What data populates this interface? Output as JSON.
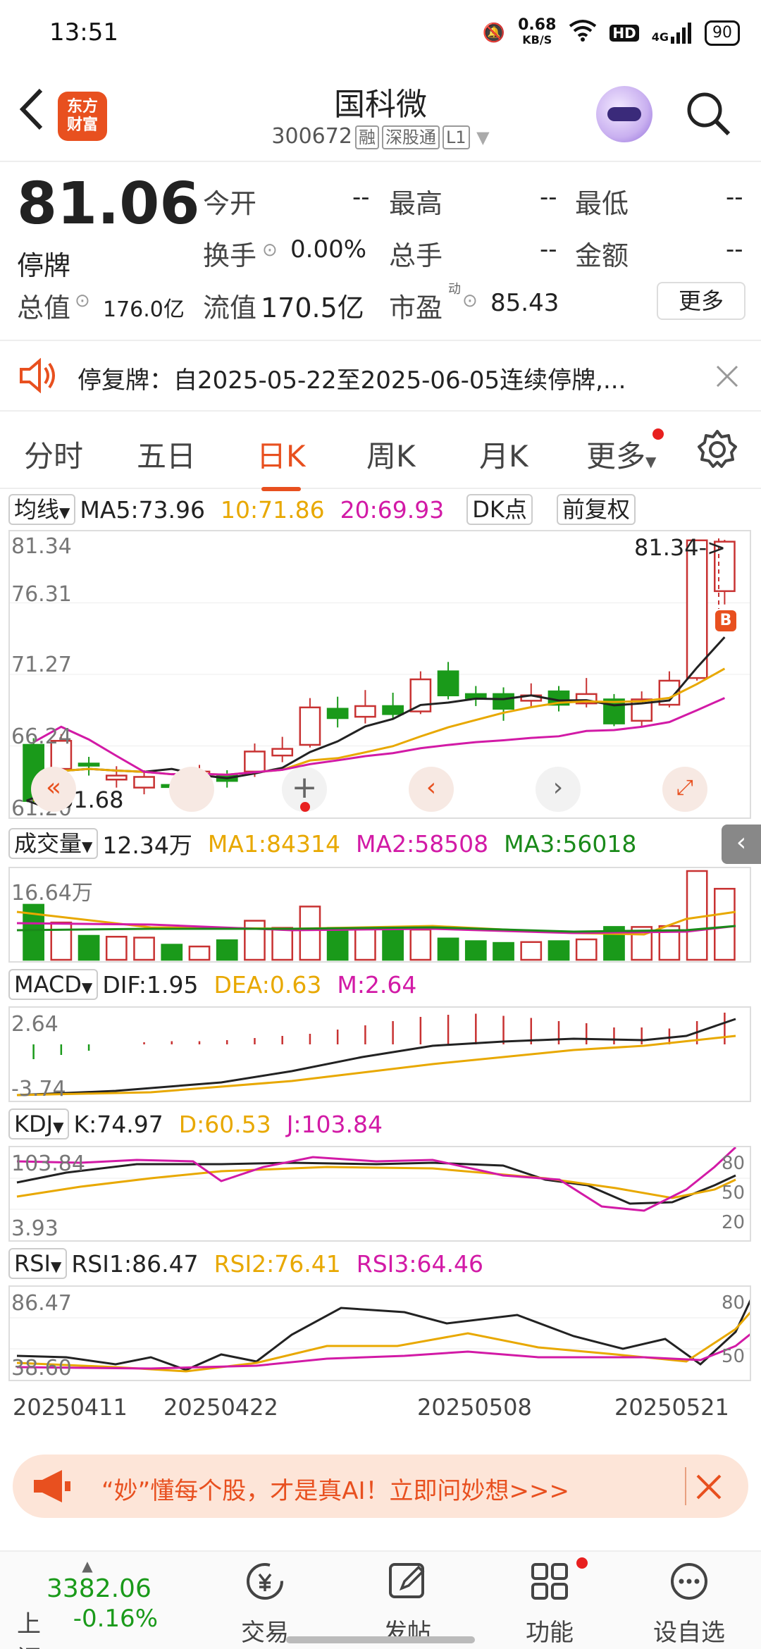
{
  "status": {
    "time": "13:51",
    "speed": "0.68",
    "speed_unit": "KB/S",
    "hd": "HD",
    "net": "4G",
    "battery": "90"
  },
  "header": {
    "logo_line1": "东方",
    "logo_line2": "财富",
    "name": "国科微",
    "code": "300672",
    "tags": [
      "融",
      "深股通",
      "L1"
    ]
  },
  "quote": {
    "price": "81.06",
    "state": "停牌",
    "row1": [
      {
        "label": "今开",
        "value": "--"
      },
      {
        "label": "最高",
        "value": "--"
      },
      {
        "label": "最低",
        "value": "--"
      }
    ],
    "row2": [
      {
        "label": "换手",
        "value": "0.00%"
      },
      {
        "label": "总手",
        "value": "--"
      },
      {
        "label": "金额",
        "value": "--"
      }
    ],
    "total_value_label": "总值",
    "total_value": "176.0亿",
    "float_value_label": "流值",
    "float_value": "170.5亿",
    "pe_label": "市盈",
    "pe_sup": "动",
    "pe_value": "85.43",
    "more": "更多"
  },
  "notice": {
    "text": "停复牌：自2025-05-22至2025-06-05连续停牌,..."
  },
  "tabs": {
    "items": [
      "分时",
      "五日",
      "日K",
      "周K",
      "月K",
      "更多"
    ],
    "active": 2
  },
  "kline_bar": {
    "selector": "均线",
    "ma5": "MA5:73.96",
    "ma10": "10:71.86",
    "ma20": "20:69.93",
    "dk": "DK点",
    "adjust": "前复权"
  },
  "kline": {
    "y_labels": [
      "81.34",
      "76.31",
      "71.27",
      "66.24",
      "61.20"
    ],
    "high_tag": "81.34->",
    "low_tag": "<--61.68",
    "b_mark": "B",
    "colors": {
      "up": "#c83232",
      "down": "#1a9a1a",
      "ma5": "#222222",
      "ma10": "#e8a800",
      "ma20": "#d21aa6"
    }
  },
  "volume_bar": {
    "selector": "成交量",
    "vol": "12.34万",
    "ma1": "MA1:84314",
    "ma2": "MA2:58508",
    "ma3": "MA3:56018",
    "y_top": "16.64万"
  },
  "macd_bar": {
    "selector": "MACD",
    "dif": "DIF:1.95",
    "dea": "DEA:0.63",
    "m": "M:2.64",
    "y_top": "2.64",
    "y_bottom": "-3.74"
  },
  "kdj_bar": {
    "selector": "KDJ",
    "k": "K:74.97",
    "d": "D:60.53",
    "j": "J:103.84",
    "y_top": "103.84",
    "y_bottom": "3.93",
    "right_ticks": [
      "80",
      "50",
      "20"
    ]
  },
  "rsi_bar": {
    "selector": "RSI",
    "rsi1": "RSI1:86.47",
    "rsi2": "RSI2:76.41",
    "rsi3": "RSI3:64.46",
    "y_top": "86.47",
    "y_bottom": "38.60",
    "right_ticks": [
      "80",
      "50"
    ]
  },
  "dates": [
    "20250411",
    "20250422",
    "20250508",
    "20250521"
  ],
  "ad": {
    "text": "“妙”懂每个股，才是真AI！立即问妙想>>>"
  },
  "bottom": {
    "index_value": "3382.06",
    "index_name": "上证",
    "index_change": "-0.16%",
    "items": [
      "交易",
      "发帖",
      "功能",
      "设自选"
    ]
  }
}
